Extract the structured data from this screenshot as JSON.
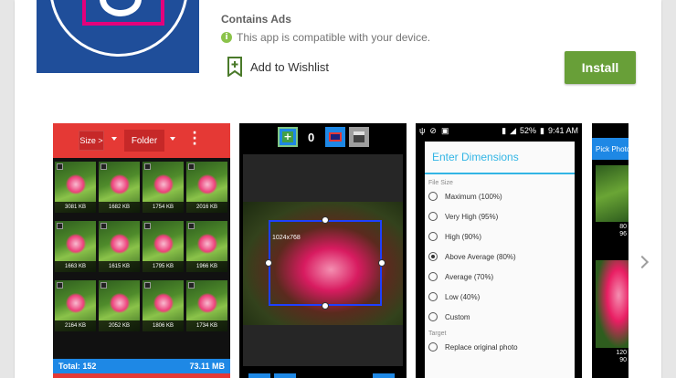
{
  "app": {
    "contains_ads": "Contains Ads",
    "compatibility": "This app is compatible with your device.",
    "wishlist_label": "Add to Wishlist",
    "install_label": "Install",
    "icons": {
      "info": "info-icon",
      "wishlist": "bookmark-plus-icon",
      "next": "chevron-right-icon"
    },
    "colors": {
      "install": "#689f38",
      "icon_bg": "#1f4e9a",
      "icon_accent": "#e4007c"
    }
  },
  "screenshot1": {
    "size_button": "Size >",
    "folder_button": "Folder",
    "thumbs": [
      "3081 KB",
      "1682 KB",
      "1754 KB",
      "2016 KB",
      "1663 KB",
      "1615 KB",
      "1795 KB",
      "1966 KB",
      "2164 KB",
      "2052 KB",
      "1806 KB",
      "1734 KB"
    ],
    "total_label": "Total: 152",
    "total_size": "73.11 MB"
  },
  "screenshot2": {
    "count": "0",
    "dimension_label": "1024x768"
  },
  "screenshot3": {
    "battery": "52%",
    "time": "9:41 AM",
    "dialog_title": "Enter Dimensions",
    "file_size_section": "File Size",
    "options": [
      {
        "label": "Maximum (100%)",
        "selected": false
      },
      {
        "label": "Very High (95%)",
        "selected": false
      },
      {
        "label": "High (90%)",
        "selected": false
      },
      {
        "label": "Above Average (80%)",
        "selected": true
      },
      {
        "label": "Average (70%)",
        "selected": false
      },
      {
        "label": "Low (40%)",
        "selected": false
      },
      {
        "label": "Custom",
        "selected": false
      }
    ],
    "target_section": "Target",
    "target_option": "Replace original photo"
  },
  "screenshot4": {
    "header": "Pick Photo",
    "caption1_a": "80",
    "caption1_b": "96",
    "caption2_a": "120",
    "caption2_b": "90"
  }
}
